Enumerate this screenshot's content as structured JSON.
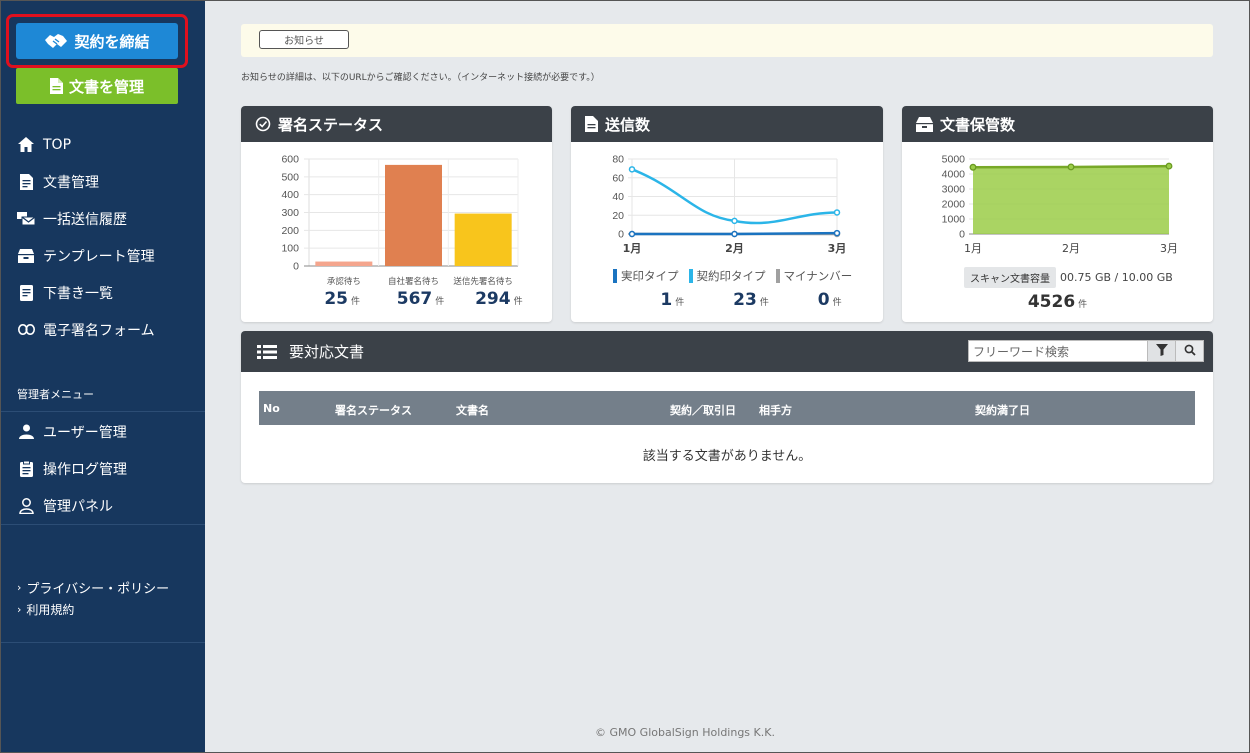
{
  "sidebar": {
    "contract_button": "契約を締結",
    "docs_button": "文書を管理",
    "nav": [
      {
        "label": "TOP",
        "icon": "home-icon",
        "name": "sidebar-item-top"
      },
      {
        "label": "文書管理",
        "icon": "document-icon",
        "name": "sidebar-item-documents"
      },
      {
        "label": "一括送信履歴",
        "icon": "bulk-send-icon",
        "name": "sidebar-item-bulk-history"
      },
      {
        "label": "テンプレート管理",
        "icon": "template-icon",
        "name": "sidebar-item-templates"
      },
      {
        "label": "下書き一覧",
        "icon": "draft-icon",
        "name": "sidebar-item-drafts"
      },
      {
        "label": "電子署名フォーム",
        "icon": "link-icon",
        "name": "sidebar-item-esign-form"
      }
    ],
    "admin_title": "管理者メニュー",
    "admin_nav": [
      {
        "label": "ユーザー管理",
        "icon": "user-icon",
        "name": "sidebar-item-users"
      },
      {
        "label": "操作ログ管理",
        "icon": "log-icon",
        "name": "sidebar-item-logs"
      },
      {
        "label": "管理パネル",
        "icon": "admin-panel-icon",
        "name": "sidebar-item-admin-panel"
      }
    ],
    "links": [
      "プライバシー・ポリシー",
      "利用規約"
    ]
  },
  "notice": {
    "button": "お知らせ",
    "text": "お知らせの詳細は、以下のURLからご確認ください。（インターネット接続が必要です。）"
  },
  "signature_status": {
    "title": "署名ステータス",
    "unit": "件",
    "stats": [
      "25",
      "567",
      "294"
    ]
  },
  "sent_count": {
    "title": "送信数",
    "unit": "件",
    "stats": [
      "1",
      "23",
      "0"
    ]
  },
  "storage": {
    "title": "文書保管数",
    "badge": "スキャン文書容量",
    "capacity": "00.75 GB / 10.00 GB",
    "count": "4526",
    "unit": "件"
  },
  "chart_data": [
    {
      "type": "bar",
      "categories": [
        "承認待ち",
        "自社署名待ち",
        "送信先署名待ち"
      ],
      "values": [
        25,
        567,
        294
      ],
      "ylim": [
        0,
        600
      ],
      "yticks": [
        0,
        100,
        200,
        300,
        400,
        500,
        600
      ],
      "colors": [
        "#f4a58d",
        "#e08050",
        "#f8c51c"
      ]
    },
    {
      "type": "line",
      "x": [
        "1月",
        "2月",
        "3月"
      ],
      "series": [
        {
          "name": "実印タイプ",
          "values": [
            0,
            0,
            1
          ],
          "color": "#1a73c0"
        },
        {
          "name": "契約印タイプ",
          "values": [
            69,
            14,
            23
          ],
          "color": "#2bb5e8"
        },
        {
          "name": "マイナンバー",
          "values": [
            0,
            0,
            0
          ],
          "color": "#a0a0a0"
        }
      ],
      "ylim": [
        0,
        80
      ],
      "yticks": [
        0,
        20,
        40,
        60,
        80
      ]
    },
    {
      "type": "area",
      "x": [
        "1月",
        "2月",
        "3月"
      ],
      "values": [
        4450,
        4470,
        4526
      ],
      "ylim": [
        0,
        5000
      ],
      "yticks": [
        0,
        1000,
        2000,
        3000,
        4000,
        5000
      ],
      "color": "#9bcd48"
    }
  ],
  "pending": {
    "title": "要対応文書",
    "search_placeholder": "フリーワード検索",
    "columns": [
      "No",
      "署名ステータス",
      "文書名",
      "契約／取引日",
      "相手方",
      "契約満了日"
    ],
    "empty": "該当する文書がありません。"
  },
  "copyright": "© GMO GlobalSign Holdings K.K."
}
